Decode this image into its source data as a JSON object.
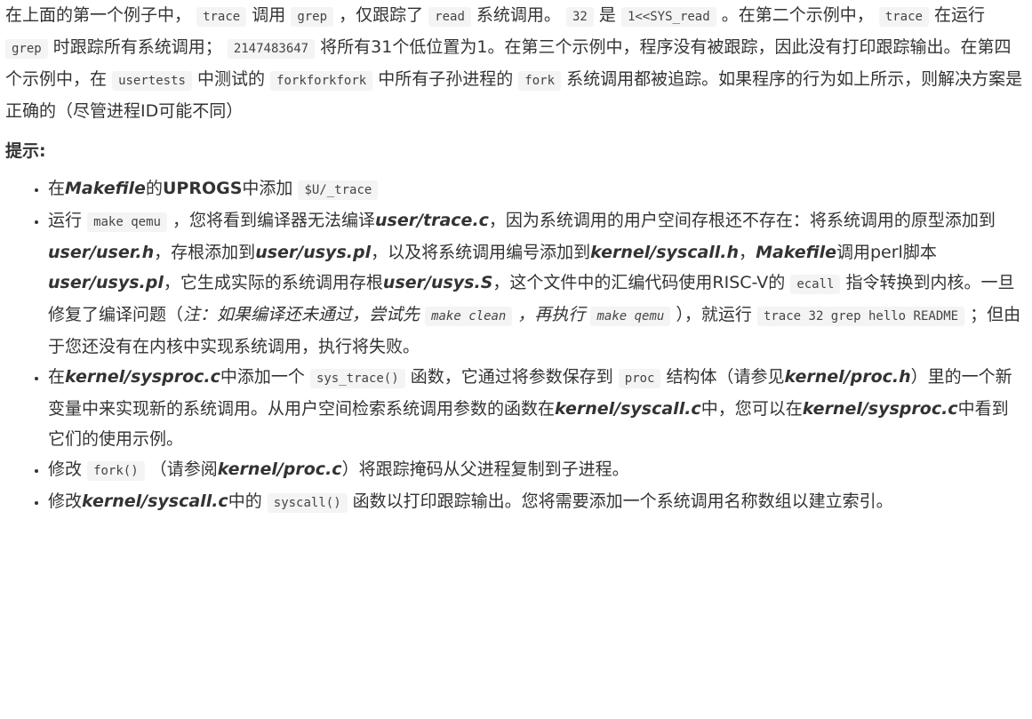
{
  "intro": {
    "t1": "在上面的第一个例子中，",
    "c1": "trace",
    "t2": "调用",
    "c2": "grep",
    "t3": "，仅跟踪了",
    "c3": "read",
    "t4": "系统调用。",
    "c4": "32",
    "t5": "是",
    "c5": "1<<SYS_read",
    "t6": "。在第二个示例中，",
    "c6": "trace",
    "t7": "在运行",
    "c7": "grep",
    "t8": "时跟踪所有系统调用；",
    "c8": "2147483647",
    "t9": "将所有31个低位置为1。在第三个示例中，程序没有被跟踪，因此没有打印跟踪输出。在第四个示例中，在",
    "c9": "usertests",
    "t10": "中测试的",
    "c10": "forkforkfork",
    "t11": "中所有子孙进程的",
    "c11": "fork",
    "t12": "系统调用都被追踪。如果程序的行为如上所示，则解决方案是正确的（尽管进程ID可能不同）"
  },
  "hints_heading": "提示:",
  "hints": {
    "h1": {
      "t1": "在",
      "e1": "Makefile",
      "t2": "的",
      "b1": "UPROGS",
      "t3": "中添加",
      "c1": "$U/_trace"
    },
    "h2": {
      "t1": "运行",
      "c1": "make qemu",
      "t2": "，您将看到编译器无法编译",
      "e1": "user/trace.c",
      "t3": "，因为系统调用的用户空间存根还不存在：将系统调用的原型添加到",
      "e2": "user/user.h",
      "t4": "，存根添加到",
      "e3": "user/usys.pl",
      "t5": "，以及将系统调用编号添加到",
      "e4": "kernel/syscall.h",
      "t6": "，",
      "e5": "Makefile",
      "t7": "调用perl脚本",
      "e6": "user/usys.pl",
      "t8": "，它生成实际的系统调用存根",
      "e7": "user/usys.S",
      "t9": "，这个文件中的汇编代码使用RISC-V的",
      "c2": "ecall",
      "t10": "指令转换到内核。一旦修复了编译问题（",
      "i1": "注：如果编译还未通过，尝试先",
      "c3": "make clean",
      "i2": "，再执行",
      "c4": "make qemu",
      "t11": "），就运行",
      "c5": "trace 32 grep hello README",
      "t12": "；但由于您还没有在内核中实现系统调用，执行将失败。"
    },
    "h3": {
      "t1": "在",
      "e1": "kernel/sysproc.c",
      "t2": "中添加一个",
      "c1": "sys_trace()",
      "t3": "函数，它通过将参数保存到",
      "c2": "proc",
      "t4": "结构体（请参见",
      "e2": "kernel/proc.h",
      "t5": "）里的一个新变量中来实现新的系统调用。从用户空间检索系统调用参数的函数在",
      "e3": "kernel/syscall.c",
      "t6": "中，您可以在",
      "e4": "kernel/sysproc.c",
      "t7": "中看到它们的使用示例。"
    },
    "h4": {
      "t1": "修改",
      "c1": "fork()",
      "t2": "（请参阅",
      "e1": "kernel/proc.c",
      "t3": "）将跟踪掩码从父进程复制到子进程。"
    },
    "h5": {
      "t1": "修改",
      "e1": "kernel/syscall.c",
      "t2": "中的",
      "c1": "syscall()",
      "t3": "函数以打印跟踪输出。您将需要添加一个系统调用名称数组以建立索引。"
    }
  }
}
